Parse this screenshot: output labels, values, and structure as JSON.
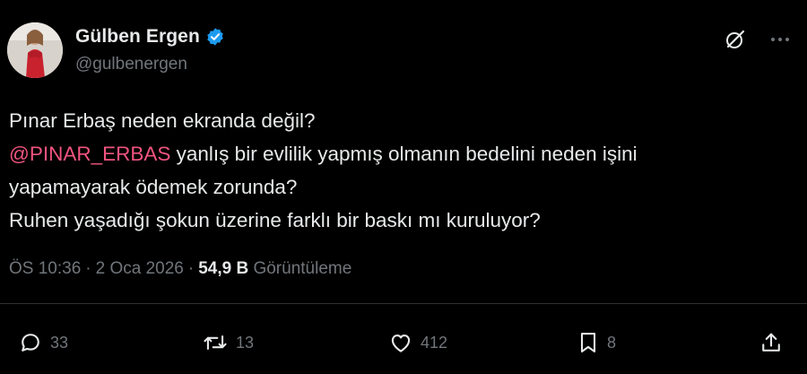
{
  "user": {
    "display_name": "Gülben Ergen",
    "handle": "@gulbenergen",
    "verified": true
  },
  "top_icons": [
    "grok-icon",
    "more-options-icon"
  ],
  "tweet": {
    "line1": "Pınar Erbaş neden ekranda değil?",
    "mention": "@PINAR_ERBAS",
    "line2_rest": " yanlış bir evlilik yapmış olmanın bedelini neden işini",
    "line3": "yapamayarak ödemek zorunda?",
    "line4": "Ruhen yaşadığı şokun üzerine farklı bir baskı mı kuruluyor?"
  },
  "meta": {
    "time": "ÖS 10:36",
    "date": "2 Oca 2026",
    "separator": "·",
    "views_count": "54,9 B",
    "views_label": "Görüntüleme"
  },
  "actions": {
    "replies": "33",
    "retweets": "13",
    "likes": "412",
    "bookmarks": "8"
  },
  "colors": {
    "background": "#000000",
    "text": "#e7e9ea",
    "secondary": "#71767b",
    "mention": "#f0547f",
    "verified": "#1d9bf0"
  }
}
